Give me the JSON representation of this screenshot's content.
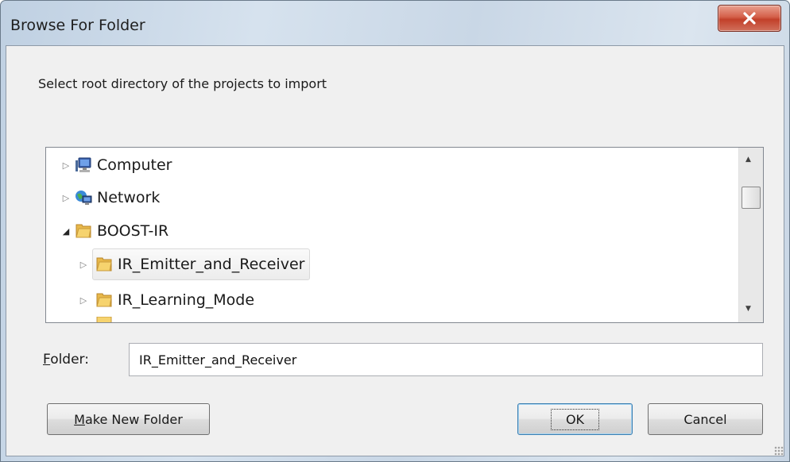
{
  "window": {
    "title": "Browse For Folder",
    "close_label": "X"
  },
  "prompt": "Select root directory of the projects to import",
  "tree": {
    "items": [
      {
        "label": "Computer",
        "icon": "computer-icon",
        "expanded": false,
        "level": 0
      },
      {
        "label": "Network",
        "icon": "network-icon",
        "expanded": false,
        "level": 0
      },
      {
        "label": "BOOST-IR",
        "icon": "folder-icon",
        "expanded": true,
        "level": 0
      },
      {
        "label": "IR_Emitter_and_Receiver",
        "icon": "folder-icon",
        "expanded": false,
        "level": 1,
        "selected": true
      },
      {
        "label": "IR_Learning_Mode",
        "icon": "folder-icon",
        "expanded": false,
        "level": 1
      }
    ]
  },
  "folder": {
    "label_prefix": "F",
    "label_rest": "older:",
    "value": "IR_Emitter_and_Receiver"
  },
  "buttons": {
    "make_new_prefix": "M",
    "make_new_rest": "ake New Folder",
    "ok": "OK",
    "cancel": "Cancel"
  },
  "colors": {
    "selection": "#ececec",
    "close_red": "#c2402a"
  }
}
